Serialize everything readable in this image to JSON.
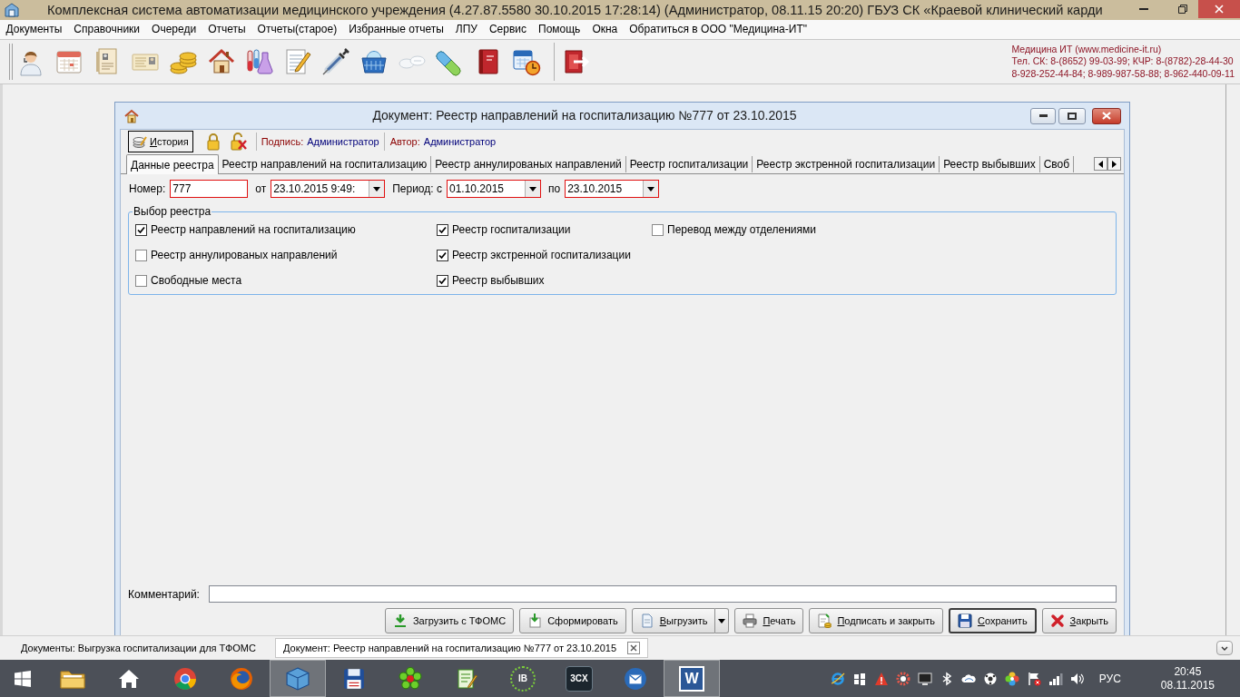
{
  "window": {
    "title": "Комплексная система автоматизации медицинского учреждения (4.27.87.5580 30.10.2015 17:28:14) (Администратор, 08.11.15 20:20) ГБУЗ СК «Краевой клинический карди"
  },
  "menu": [
    "Документы",
    "Справочники",
    "Очереди",
    "Отчеты",
    "Отчеты(старое)",
    "Избранные отчеты",
    "ЛПУ",
    "Сервис",
    "Помощь",
    "Окна",
    "Обратиться в ООО \"Медицина-ИТ\""
  ],
  "contacts": [
    "Медицина ИТ (www.medicine-it.ru)",
    "Тел. СК: 8-(8652) 99-03-99; КЧР: 8-(8782)-28-44-30",
    "8-928-252-44-84; 8-989-987-58-88; 8-962-440-09-11"
  ],
  "dialog": {
    "title": "Документ: Реестр направлений на госпитализацию №777 от 23.10.2015",
    "history_button": {
      "label": "История",
      "hotkey": true,
      "focused": true
    },
    "signature": {
      "label": "Подпись:",
      "value": "Администратор"
    },
    "author": {
      "label": "Автор:",
      "value": "Администратор"
    },
    "tabs": [
      {
        "label": "Данные реестра",
        "selected": true
      },
      {
        "label": "Реестр направлений на госпитализацию",
        "selected": false
      },
      {
        "label": "Реестр аннулированых направлений",
        "selected": false
      },
      {
        "label": "Реестр госпитализации",
        "selected": false
      },
      {
        "label": "Реестр экстренной госпитализации",
        "selected": false
      },
      {
        "label": "Реестр выбывших",
        "selected": false
      },
      {
        "label": "Своб",
        "selected": false
      }
    ],
    "fields": [
      {
        "label": "Номер:",
        "value": "777",
        "kind": "text",
        "invalid": true
      },
      {
        "label": "от",
        "value": "23.10.2015 9:49:",
        "kind": "date",
        "invalid": true
      },
      {
        "label": "Период: с",
        "value": "01.10.2015",
        "kind": "date",
        "invalid": true
      },
      {
        "label": "по",
        "value": "23.10.2015",
        "kind": "date",
        "invalid": true
      }
    ],
    "group": {
      "title": "Выбор реестра",
      "columns": [
        [
          {
            "label": "Реестр направлений на госпитализацию",
            "checked": true
          },
          {
            "label": "Реестр аннулированых направлений",
            "checked": false
          },
          {
            "label": "Свободные места",
            "checked": false
          }
        ],
        [
          {
            "label": "Реестр госпитализации",
            "checked": true
          },
          {
            "label": "Реестр экстренной госпитализации",
            "checked": true
          },
          {
            "label": "Реестр выбывших",
            "checked": true
          }
        ],
        [
          {
            "label": "Перевод между отделениями",
            "checked": false
          }
        ]
      ]
    },
    "comment": {
      "label": "Комментарий:",
      "invalid": false
    },
    "buttons": [
      {
        "label": "Загрузить с ТФОМС",
        "kind": "download",
        "hotkey": false,
        "focused": false,
        "split": false
      },
      {
        "label": "Сформировать",
        "kind": "generate",
        "hotkey": false,
        "focused": false,
        "split": false
      },
      {
        "label": "Выгрузить",
        "kind": "export",
        "hotkey": true,
        "focused": false,
        "split": true
      },
      {
        "label": "Печать",
        "kind": "print",
        "hotkey": true,
        "focused": false,
        "split": false
      },
      {
        "label": "Подписать и закрыть",
        "kind": "sign",
        "hotkey": true,
        "focused": false,
        "split": false
      },
      {
        "label": "Сохранить",
        "kind": "save",
        "hotkey": true,
        "focused": true,
        "split": false
      },
      {
        "label": "Закрыть",
        "kind": "close",
        "hotkey": true,
        "focused": false,
        "split": false
      }
    ]
  },
  "document_tabs": [
    {
      "label": "Документы: Выгрузка госпитализации для ТФОМС",
      "selected": false
    },
    {
      "label": "Документ: Реестр направлений на госпитализацию №777 от 23.10.2015",
      "selected": true
    }
  ],
  "taskbar": {
    "apps": [
      {
        "kind": "start",
        "active": false
      },
      {
        "kind": "folder",
        "active": false
      },
      {
        "kind": "home",
        "active": false
      },
      {
        "kind": "tricolor",
        "active": false
      },
      {
        "kind": "orange",
        "active": false
      },
      {
        "kind": "cube",
        "active": true
      },
      {
        "kind": "floppy",
        "active": false
      },
      {
        "kind": "flower",
        "active": false
      },
      {
        "kind": "notepad",
        "active": false
      },
      {
        "kind": "ring_logo",
        "text": "IB",
        "active": false
      },
      {
        "kind": "tile_logo",
        "text": "3CX",
        "active": false
      },
      {
        "kind": "mail",
        "active": false
      },
      {
        "kind": "doc_logo",
        "text": "W",
        "active": true
      }
    ],
    "language": "РУС",
    "time": "20:45",
    "date": "08.11.2015"
  }
}
